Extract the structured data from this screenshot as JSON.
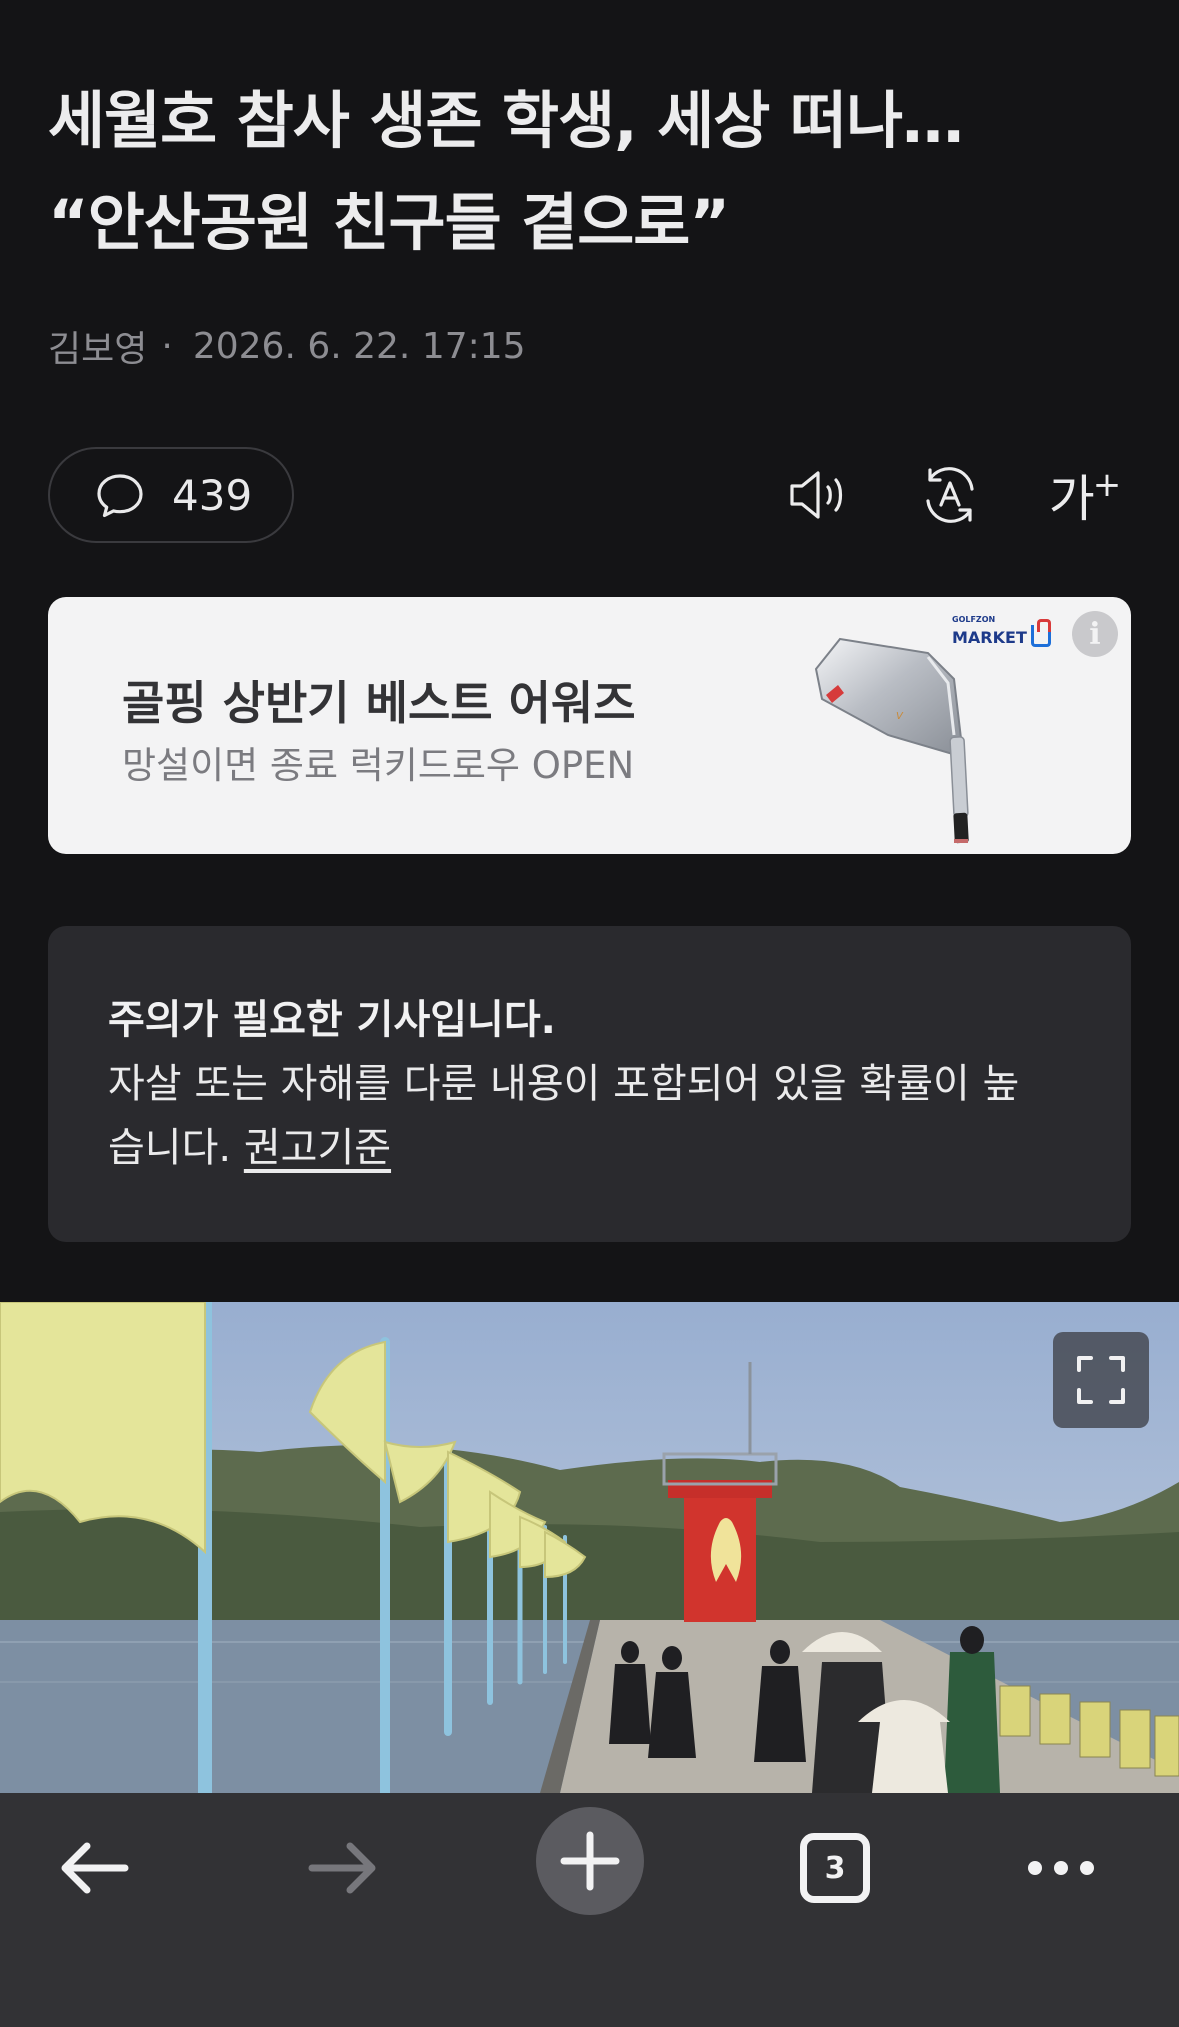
{
  "article": {
    "title_line1": "세월호 참사 생존 학생, 세상 떠나…",
    "title_line2": "“안산공원 친구들 곁으로”",
    "author": "김보영",
    "separator": "·",
    "datetime": "2026. 6. 22. 17:15"
  },
  "actions": {
    "comment_count": "439",
    "comment_icon": "speech-bubble-icon",
    "tts_icon": "speaker-icon",
    "translate_icon": "auto-translate-icon",
    "font_size_label": "가",
    "font_size_plus": "+"
  },
  "ad": {
    "title": "골핑 상반기 베스트 어워즈",
    "subtitle": "망설이면 종료 럭키드로우 OPEN",
    "brand_small": "GOLFZON",
    "brand_big": "MARKET",
    "info_label": "i"
  },
  "warning": {
    "title": "주의가 필요한 기사입니다.",
    "line2": "자살 또는 자해를 다룬 내용이 포함되어 있을 확률이 높",
    "line3": "습니다. ",
    "link": "권고기준"
  },
  "photo": {
    "expand_icon": "fullscreen-expand-icon"
  },
  "toolbar": {
    "back_icon": "arrow-left-icon",
    "forward_icon": "arrow-right-icon",
    "new_tab_icon": "plus-icon",
    "tab_count": "3",
    "more_icon": "more-dots-icon"
  },
  "colors": {
    "background": "#141416",
    "card": "#2a2a2e",
    "toolbar": "#323235",
    "ad_background": "#f3f3f4"
  }
}
